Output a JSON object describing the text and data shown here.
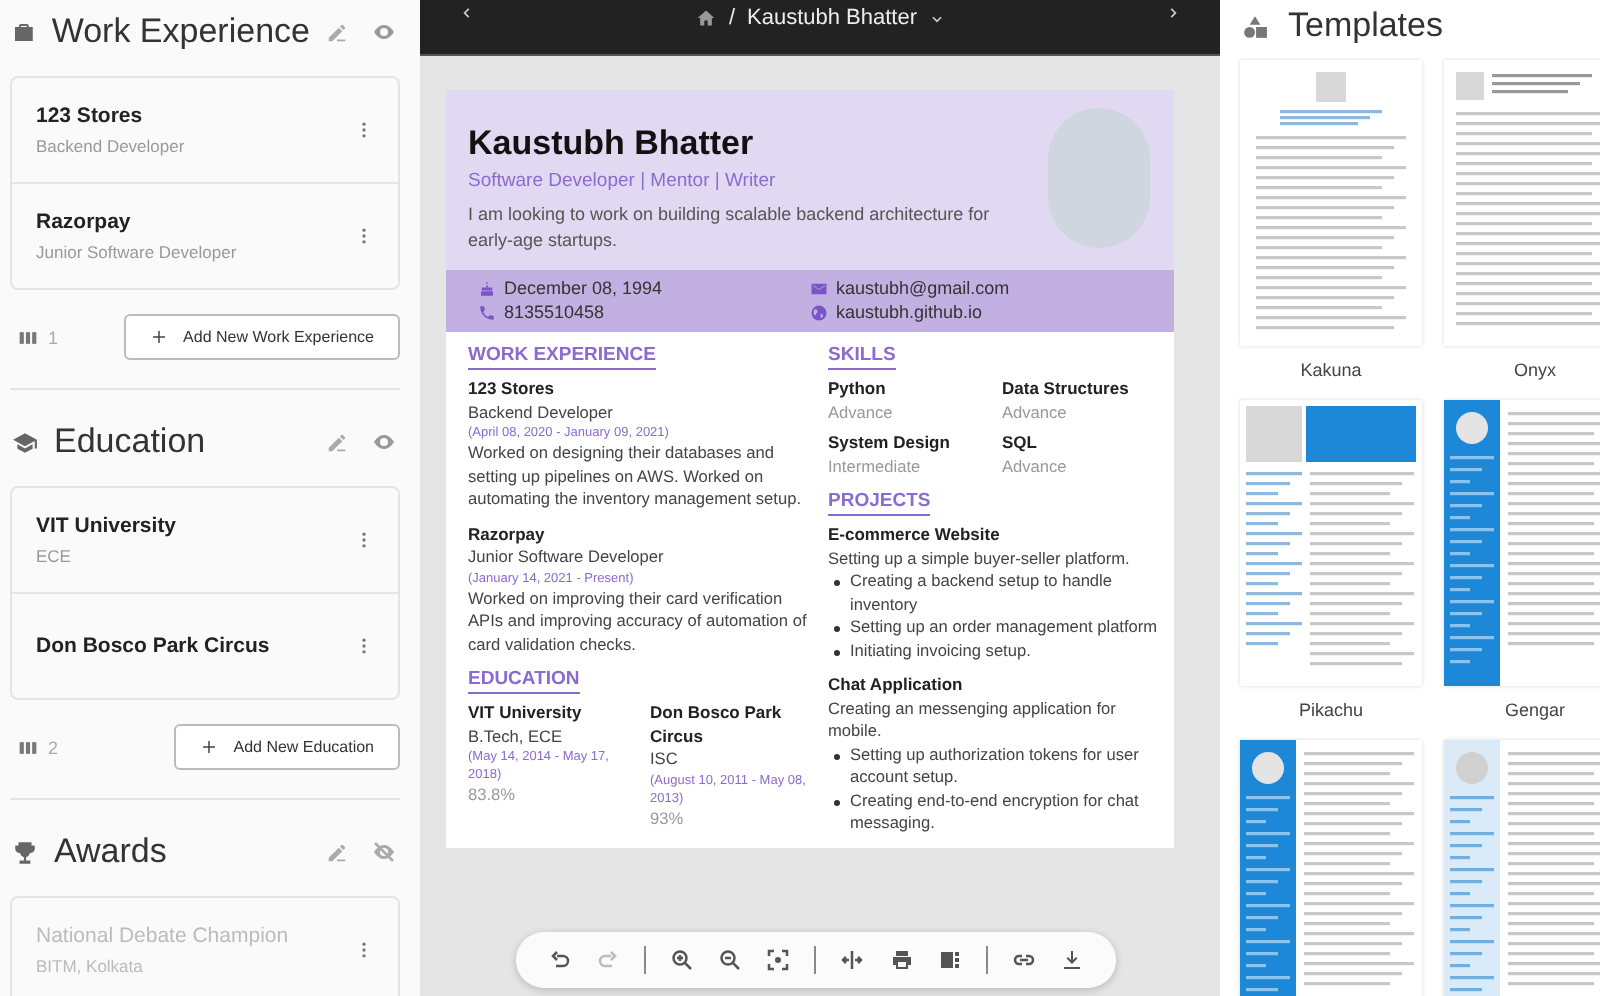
{
  "left_sections": [
    {
      "kind": "work",
      "title": "Work Experience",
      "visible": true,
      "items": [
        {
          "title": "123 Stores",
          "subtitle": "Backend Developer"
        },
        {
          "title": "Razorpay",
          "subtitle": "Junior Software Developer"
        }
      ],
      "count": "1",
      "add_label": "Add New Work Experience"
    },
    {
      "kind": "education",
      "title": "Education",
      "visible": true,
      "items": [
        {
          "title": "VIT University",
          "subtitle": "ECE"
        },
        {
          "title": "Don Bosco Park Circus"
        }
      ],
      "count": "2",
      "add_label": "Add New Education"
    },
    {
      "kind": "awards",
      "title": "Awards",
      "visible": false,
      "items": [
        {
          "title": "National Debate Champion",
          "subtitle": "BITM, Kolkata"
        }
      ]
    }
  ],
  "preview": {
    "separator": "/",
    "title": "Kaustubh Bhatter",
    "resume": {
      "name": "Kaustubh Bhatter",
      "headline": "Software Developer | Mentor | Writer",
      "summary": "I am looking to work on building scalable backend architecture for early-age startups.",
      "contacts": [
        {
          "kind": "birthday",
          "text": "December 08, 1994"
        },
        {
          "kind": "email",
          "text": "kaustubh@gmail.com"
        },
        {
          "kind": "phone",
          "text": "8135510458"
        },
        {
          "kind": "website",
          "text": "kaustubh.github.io"
        }
      ],
      "work": {
        "heading": "WORK EXPERIENCE",
        "items": [
          {
            "company": "123 Stores",
            "position": "Backend Developer",
            "dates": "(April 08, 2020 - January 09, 2021)",
            "summary": "Worked on designing their databases and setting up pipelines on AWS. Worked on automating the inventory management setup."
          },
          {
            "company": "Razorpay",
            "position": "Junior Software Developer",
            "dates": "(January 14, 2021 - Present)",
            "summary": "Worked on improving their card verification APIs and improving accuracy of automation of card validation checks."
          }
        ]
      },
      "education": {
        "heading": "EDUCATION",
        "items": [
          {
            "institution": "VIT University",
            "degree": "B.Tech, ECE",
            "dates": "(May 14, 2014 - May 17, 2018)",
            "score": "83.8%"
          },
          {
            "institution": "Don Bosco Park Circus",
            "degree": "ISC",
            "dates": "(August 10, 2011 - May 08, 2013)",
            "score": "93%"
          }
        ]
      },
      "skills": {
        "heading": "SKILLS",
        "items": [
          {
            "name": "Python",
            "proficiency": "Advance"
          },
          {
            "name": "Data Structures",
            "proficiency": "Advance"
          },
          {
            "name": "System Design",
            "proficiency": "Intermediate"
          },
          {
            "name": "SQL",
            "proficiency": "Advance"
          }
        ]
      },
      "projects": {
        "heading": "PROJECTS",
        "items": [
          {
            "title": "E-commerce Website",
            "summary": "Setting up a simple buyer-seller platform.",
            "bullets": [
              "Creating a backend setup to handle inventory",
              "Setting up an order management platform",
              "Initiating invoicing setup."
            ]
          },
          {
            "title": "Chat Application",
            "summary": "Creating an messenging application for mobile.",
            "bullets": [
              "Setting up authorization tokens for user account setup.",
              "Creating end-to-end encryption for chat messaging."
            ]
          }
        ]
      }
    }
  },
  "templates": {
    "title": "Templates",
    "items": [
      {
        "kind": "centered",
        "name": "Kakuna"
      },
      {
        "kind": "left-photo",
        "name": "Onyx"
      },
      {
        "kind": "blue-header",
        "name": "Pikachu"
      },
      {
        "kind": "blue-sidebar",
        "name": "Gengar"
      },
      {
        "kind": "blue-sidebar"
      },
      {
        "kind": "light-sidebar"
      }
    ]
  }
}
